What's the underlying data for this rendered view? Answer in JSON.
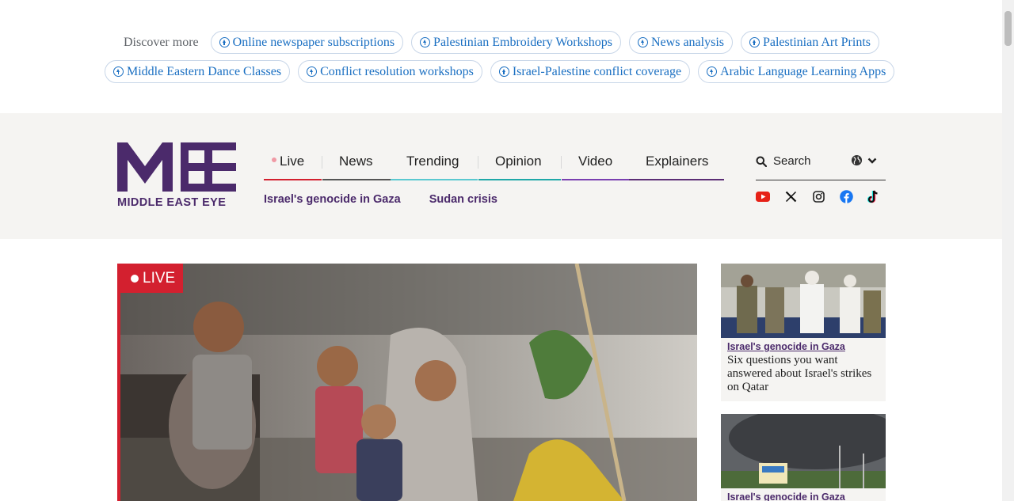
{
  "discover": {
    "label": "Discover more",
    "row1": [
      "Online newspaper subscriptions",
      "Palestinian Embroidery Workshops",
      "News analysis",
      "Palestinian Art Prints"
    ],
    "row2": [
      "Middle Eastern Dance Classes",
      "Conflict resolution workshops",
      "Israel-Palestine conflict coverage",
      "Arabic Language Learning Apps"
    ]
  },
  "header": {
    "logo_text": "MIDDLE EAST EYE",
    "nav": [
      "Live",
      "News",
      "Trending",
      "Opinion",
      "Video",
      "Explainers"
    ],
    "sub_nav": [
      "Israel's genocide in Gaza",
      "Sudan crisis"
    ],
    "search_label": "Search",
    "colors": {
      "brand": "#4b2a6b",
      "live": "#d3202f"
    }
  },
  "hero": {
    "badge": "LIVE"
  },
  "cards": [
    {
      "tag": "Israel's genocide in Gaza",
      "title": "Six questions you want answered about Israel's strikes on Qatar"
    },
    {
      "tag": "Israel's genocide in Gaza",
      "title": ""
    }
  ]
}
